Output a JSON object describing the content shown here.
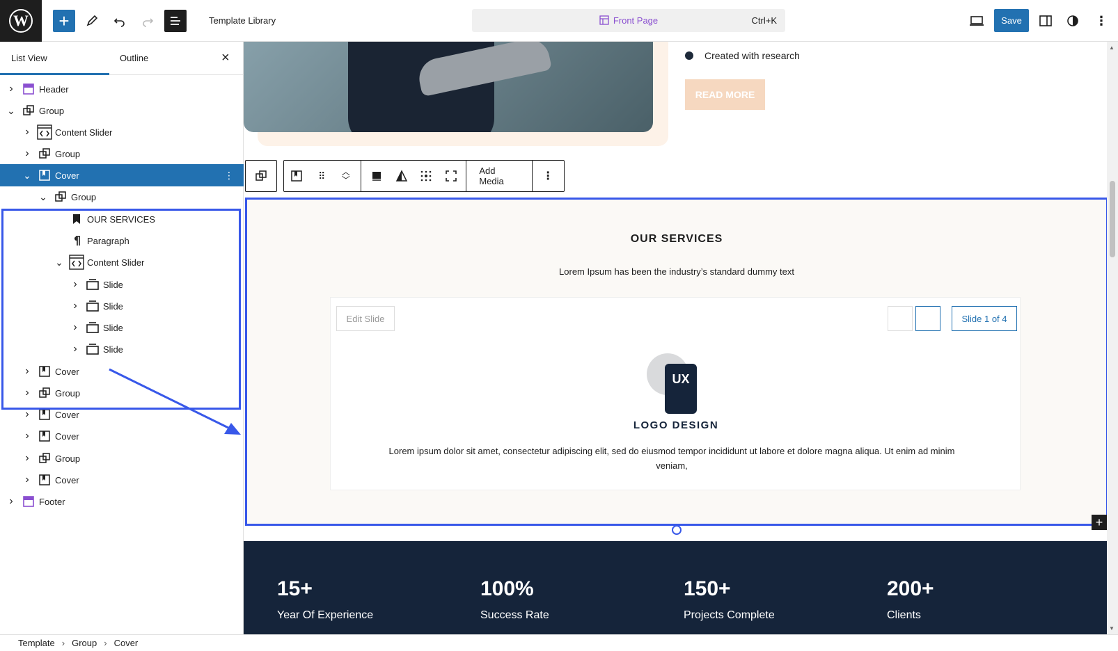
{
  "topbar": {
    "doc_title": "Template Library",
    "command": {
      "label": "Front Page",
      "shortcut": "Ctrl+K"
    },
    "save_label": "Save"
  },
  "sidebar": {
    "tabs": {
      "list_view": "List View",
      "outline": "Outline"
    },
    "tree": [
      {
        "label": "Header",
        "icon": "template-part-icon",
        "depth": 0,
        "expanded": false
      },
      {
        "label": "Group",
        "icon": "group-icon",
        "depth": 0,
        "expanded": true
      },
      {
        "label": "Content Slider",
        "icon": "code-slider-icon",
        "depth": 1,
        "expanded": false
      },
      {
        "label": "Group",
        "icon": "group-icon",
        "depth": 1,
        "expanded": false
      },
      {
        "label": "Cover",
        "icon": "cover-icon",
        "depth": 1,
        "expanded": true,
        "selected": true
      },
      {
        "label": "Group",
        "icon": "group-icon",
        "depth": 2,
        "expanded": true
      },
      {
        "label": "OUR SERVICES",
        "icon": "heading-bookmark-icon",
        "depth": 3,
        "leaf": true
      },
      {
        "label": "Paragraph",
        "icon": "paragraph-icon",
        "depth": 3,
        "leaf": true
      },
      {
        "label": "Content Slider",
        "icon": "code-slider-icon",
        "depth": 3,
        "expanded": true
      },
      {
        "label": "Slide",
        "icon": "slide-icon",
        "depth": 4,
        "expanded": false
      },
      {
        "label": "Slide",
        "icon": "slide-icon",
        "depth": 4,
        "expanded": false
      },
      {
        "label": "Slide",
        "icon": "slide-icon",
        "depth": 4,
        "expanded": false
      },
      {
        "label": "Slide",
        "icon": "slide-icon",
        "depth": 4,
        "expanded": false
      },
      {
        "label": "Cover",
        "icon": "cover-icon",
        "depth": 1,
        "expanded": false
      },
      {
        "label": "Group",
        "icon": "group-icon",
        "depth": 1,
        "expanded": false
      },
      {
        "label": "Cover",
        "icon": "cover-icon",
        "depth": 1,
        "expanded": false
      },
      {
        "label": "Cover",
        "icon": "cover-icon",
        "depth": 1,
        "expanded": false
      },
      {
        "label": "Group",
        "icon": "group-icon",
        "depth": 1,
        "expanded": false
      },
      {
        "label": "Cover",
        "icon": "cover-icon",
        "depth": 1,
        "expanded": false
      },
      {
        "label": "Footer",
        "icon": "template-part-icon",
        "depth": 0,
        "expanded": false
      }
    ]
  },
  "canvas": {
    "bullet_text": "Created with research",
    "read_more": "READ MORE",
    "toolbar": {
      "add_media": "Add Media"
    },
    "services": {
      "title": "OUR SERVICES",
      "subtitle": "Lorem Ipsum has been the industry’s standard dummy text",
      "edit_slide": "Edit Slide",
      "slide_count": "Slide 1 of 4",
      "logo_glyph": "UX",
      "logo_label": "LOGO DESIGN",
      "slide_text": "Lorem ipsum dolor sit amet, consectetur adipiscing elit, sed do eiusmod tempor incididunt ut labore et dolore magna aliqua. Ut enim ad minim veniam,"
    },
    "stats": [
      {
        "num": "15+",
        "label": "Year Of Experience"
      },
      {
        "num": "100%",
        "label": "Success Rate"
      },
      {
        "num": "150+",
        "label": "Projects Complete"
      },
      {
        "num": "200+",
        "label": "Clients"
      }
    ]
  },
  "breadcrumb": [
    "Template",
    "Group",
    "Cover"
  ],
  "colors": {
    "accent": "#2271b1",
    "highlight": "#3858e9",
    "dark_navy": "#15243a",
    "command_purple": "#8a4fd0"
  }
}
